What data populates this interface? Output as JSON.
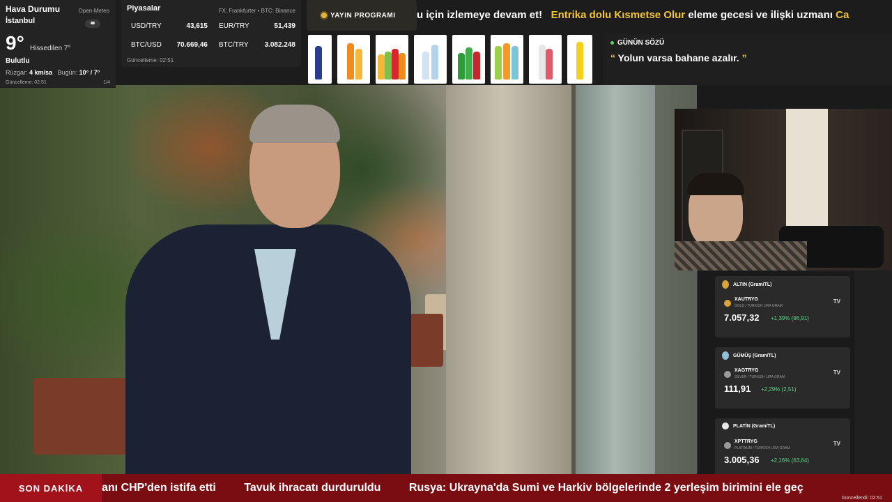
{
  "weather": {
    "title": "Hava Durumu",
    "source": "Open-Meteo",
    "city": "İstanbul",
    "temp": "9°",
    "feels": "Hissedilen 7°",
    "condition": "Bulutlu",
    "wind_label": "Rüzgar:",
    "wind_value": "4 km/sa",
    "today_label": "Bugün:",
    "today_value": "10° / 7°",
    "updated": "Güncelleme: 02:51",
    "page": "1/4"
  },
  "markets": {
    "title": "Piyasalar",
    "source": "FX: Frankfurter • BTC: Binance",
    "rows": [
      {
        "label": "USD/TRY",
        "value": "43,615"
      },
      {
        "label": "EUR/TRY",
        "value": "51,439"
      },
      {
        "label": "BTC/USD",
        "value": "70.669,46"
      },
      {
        "label": "BTC/TRY",
        "value": "3.082.248"
      }
    ],
    "updated": "Güncelleme: 02:51"
  },
  "broadcast": {
    "label": "YAYIN PROGRAMI",
    "ticker_a": "u için izlemeye devam et!",
    "ticker_b": "Entrika dolu Kısmetse Olur",
    "ticker_c": "eleme gecesi ve ilişki uzmanı",
    "ticker_d": "Ca"
  },
  "quote": {
    "title": "GÜNÜN SÖZÜ",
    "text": "Yolun varsa bahane azalır.",
    "open_mark": "“",
    "close_mark": "”"
  },
  "metals": [
    {
      "title": "ALTIN (Gram/TL)",
      "symbol": "XAUTRYG",
      "desc": "GOLD / TURKISH LIRA GRAM",
      "price": "7.057,32",
      "change": "+1,39% (96,91)",
      "tv": "TV",
      "color": "#d9a33a"
    },
    {
      "title": "GÜMÜŞ (Gram/TL)",
      "symbol": "XAGTRYG",
      "desc": "SILVER / TURKISH LIRA GRAM",
      "price": "111,91",
      "change": "+2,29% (2,51)",
      "tv": "TV",
      "color": "#8fc0d8"
    },
    {
      "title": "PLATİN (Gram/TL)",
      "symbol": "XPTTRYG",
      "desc": "PLATINUM / TURKISH LIRA GRAM",
      "price": "3.005,36",
      "change": "+2,16% (63,64)",
      "tv": "TV",
      "color": "#e8e8e8"
    }
  ],
  "breaking": {
    "label": "SON DAKİKA",
    "items": [
      "anı CHP'den istifa etti",
      "Tavuk ihracatı durduruldu",
      "Rusya: Ukrayna'da Sumi ve Harkiv bölgelerinde 2 yerleşim birimini ele geç"
    ],
    "updated": "Güncellendi: 02:51"
  }
}
